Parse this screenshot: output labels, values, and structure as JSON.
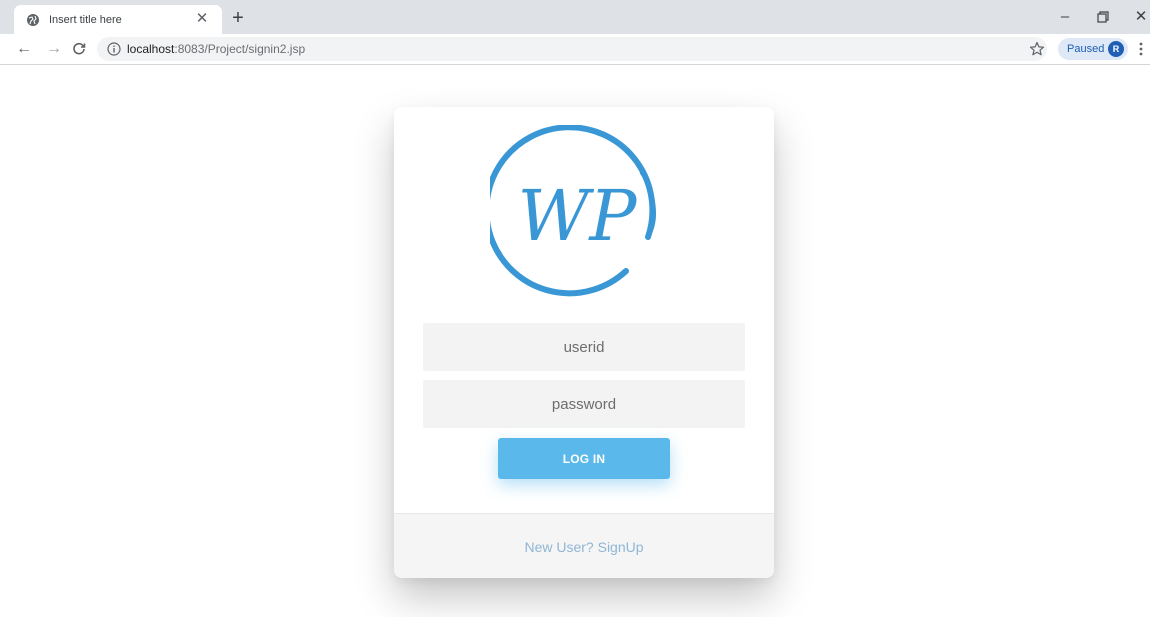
{
  "browser": {
    "tab_title": "Insert title here",
    "url_host": "localhost",
    "url_path": ":8083/Project/signin2.jsp",
    "profile_status": "Paused",
    "profile_initial": "R",
    "icons": [
      "globe-icon",
      "close-icon",
      "plus-icon",
      "minimize-icon",
      "restore-icon",
      "window-close-icon",
      "back-arrow-icon",
      "forward-arrow-icon",
      "reload-icon",
      "info-icon",
      "star-icon",
      "menu-dots-icon"
    ]
  },
  "login": {
    "logo_text": "WP",
    "userid_placeholder": "userid",
    "password_placeholder": "password",
    "login_label": "LOG IN",
    "signup_label": "New User? SignUp"
  },
  "colors": {
    "accent": "#5bb8ea",
    "logo": "#3a97d6",
    "link": "#8fb6d6"
  }
}
